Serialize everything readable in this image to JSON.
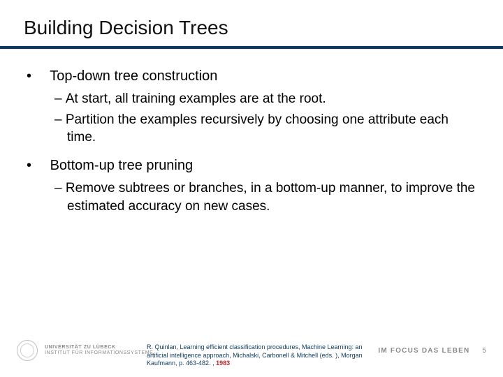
{
  "title": "Building Decision Trees",
  "bullets": {
    "b1": {
      "text": "Top-down tree construction",
      "sub": {
        "s1": "At start, all training examples are at the root.",
        "s2": "Partition the examples recursively by choosing one attribute each time."
      }
    },
    "b2": {
      "text": "Bottom-up tree pruning",
      "sub": {
        "s1": "Remove subtrees or branches, in a bottom-up manner, to improve the estimated accuracy on new cases."
      }
    }
  },
  "citation": {
    "text": "R. Quinlan, Learning efficient classification procedures, Machine Learning: an artificial intelligence approach, Michalski, Carbonell & Mitchell (eds. ), Morgan Kaufmann, p. 463-482. , ",
    "year": "1983"
  },
  "footer": {
    "uni_line1": "UNIVERSITÄT ZU LÜBECK",
    "uni_line2": "INSTITUT FÜR INFORMATIONSSYSTEME",
    "motto": "IM FOCUS DAS LEBEN",
    "page": "5"
  }
}
